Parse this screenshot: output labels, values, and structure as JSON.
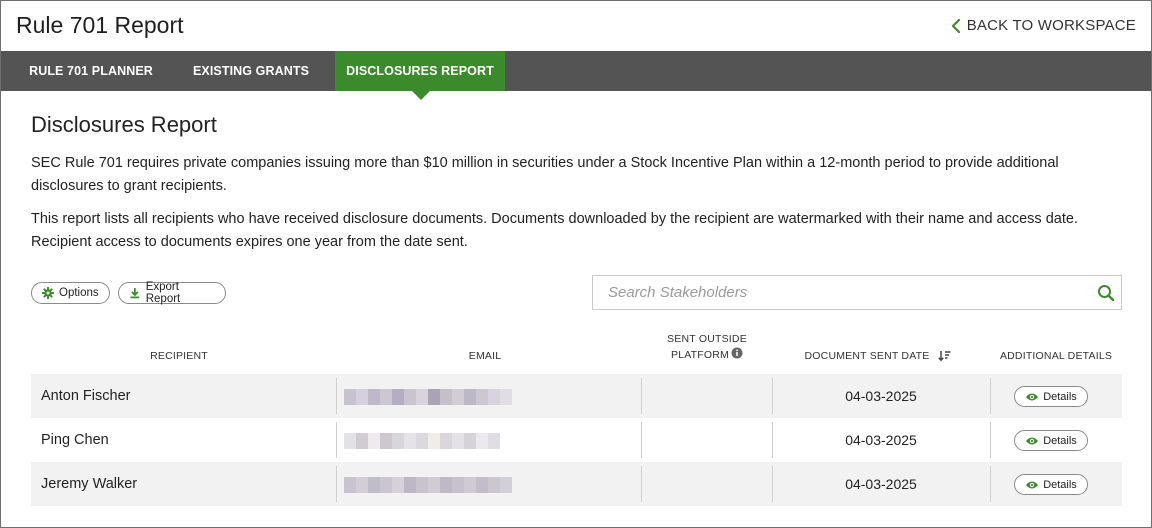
{
  "header": {
    "title": "Rule 701 Report",
    "back_label": "BACK TO WORKSPACE"
  },
  "nav": {
    "tabs": [
      {
        "label": "RULE 701 PLANNER",
        "active": false
      },
      {
        "label": "EXISTING GRANTS",
        "active": false
      },
      {
        "label": "DISCLOSURES REPORT",
        "active": true
      }
    ]
  },
  "main": {
    "title": "Disclosures Report",
    "paragraph_1": "SEC Rule 701 requires private companies issuing more than $10 million in securities under a Stock Incentive Plan within a 12-month period to provide additional disclosures to grant recipients.",
    "paragraph_2": "This report lists all recipients who have received disclosure documents. Documents downloaded by the recipient are watermarked with their name and access date. Recipient access to documents expires one year from the date sent."
  },
  "toolbar": {
    "options_label": "Options",
    "export_label": "Export Report",
    "search_placeholder": "Search Stakeholders"
  },
  "table": {
    "headers": {
      "recipient": "RECIPIENT",
      "email": "EMAIL",
      "sent_outside_line1": "SENT OUTSIDE",
      "sent_outside_line2": "PLATFORM",
      "document_sent_date": "DOCUMENT SENT DATE",
      "additional_details": "ADDITIONAL DETAILS"
    },
    "details_label": "Details",
    "rows": [
      {
        "name": "Anton Fischer",
        "email": "",
        "sent_outside": "",
        "date": "04-03-2025"
      },
      {
        "name": "Ping Chen",
        "email": "",
        "sent_outside": "",
        "date": "04-03-2025"
      },
      {
        "name": "Jeremy Walker",
        "email": "",
        "sent_outside": "",
        "date": "04-03-2025"
      }
    ]
  },
  "colors": {
    "accent_green": "#3b8a2c",
    "nav_bg": "#545454",
    "row_stripe": "#f2f2f2"
  },
  "icons": {
    "back": "chevron-left-icon",
    "options": "gear-icon",
    "export": "download-icon",
    "search": "search-icon",
    "info": "info-icon",
    "sort": "sort-descending-icon",
    "details": "eye-icon"
  }
}
